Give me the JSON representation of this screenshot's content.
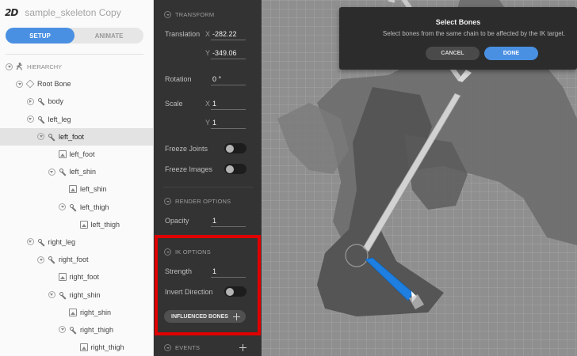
{
  "app": {
    "logo": "2D",
    "title": "sample_skeleton Copy"
  },
  "modes": {
    "setup": "SETUP",
    "animate": "ANIMATE"
  },
  "hierarchy": {
    "header": "HIERARCHY",
    "items": [
      {
        "label": "Root Bone",
        "icon": "root-icon",
        "twist": "open"
      },
      {
        "label": "body",
        "icon": "bone-icon",
        "twist": "closed"
      },
      {
        "label": "left_leg",
        "icon": "bone-icon",
        "twist": "open"
      },
      {
        "label": "left_foot",
        "icon": "bone-icon",
        "twist": "open",
        "selected": true
      },
      {
        "label": "left_foot",
        "icon": "image-icon"
      },
      {
        "label": "left_shin",
        "icon": "bone-icon",
        "twist": "open"
      },
      {
        "label": "left_shin",
        "icon": "image-icon"
      },
      {
        "label": "left_thigh",
        "icon": "bone-icon",
        "twist": "open"
      },
      {
        "label": "left_thigh",
        "icon": "image-icon"
      },
      {
        "label": "right_leg",
        "icon": "bone-icon",
        "twist": "open"
      },
      {
        "label": "right_foot",
        "icon": "bone-icon",
        "twist": "open"
      },
      {
        "label": "right_foot",
        "icon": "image-icon"
      },
      {
        "label": "right_shin",
        "icon": "bone-icon",
        "twist": "open"
      },
      {
        "label": "right_shin",
        "icon": "image-icon"
      },
      {
        "label": "right_thigh",
        "icon": "bone-icon",
        "twist": "open"
      },
      {
        "label": "right_thigh",
        "icon": "image-icon"
      }
    ]
  },
  "transform": {
    "header": "TRANSFORM",
    "translation_label": "Translation",
    "x_axis": "X",
    "y_axis": "Y",
    "translation_x": "-282.22",
    "translation_y": "-349.06",
    "rotation_label": "Rotation",
    "rotation": "0 °",
    "scale_label": "Scale",
    "scale_x": "1",
    "scale_y": "1",
    "freeze_joints_label": "Freeze Joints",
    "freeze_images_label": "Freeze Images"
  },
  "render_options": {
    "header": "RENDER OPTIONS",
    "opacity_label": "Opacity",
    "opacity": "1"
  },
  "ik_options": {
    "header": "IK OPTIONS",
    "strength_label": "Strength",
    "strength": "1",
    "invert_label": "Invert Direction",
    "influenced_bones_label": "INFLUENCED BONES"
  },
  "events": {
    "header": "EVENTS"
  },
  "dialog": {
    "title": "Select Bones",
    "message": "Select bones from the same chain to be affected by the IK target.",
    "cancel": "CANCEL",
    "done": "DONE"
  },
  "colors": {
    "accent": "#4a90e2",
    "highlight": "#e00000",
    "panel": "#333333",
    "bone_selected": "#1e7fe0"
  }
}
